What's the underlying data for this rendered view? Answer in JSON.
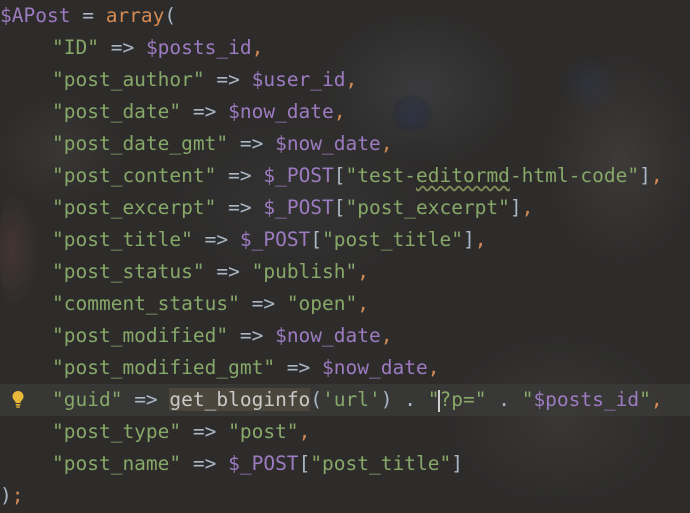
{
  "editor": {
    "lines": [
      {
        "tokens": [
          {
            "t": "$APost",
            "c": "var"
          },
          {
            "t": " = ",
            "c": "op"
          },
          {
            "t": "array",
            "c": "kw"
          },
          {
            "t": "(",
            "c": "op"
          }
        ]
      },
      {
        "indent": true,
        "tokens": [
          {
            "t": "\"ID\"",
            "c": "str"
          },
          {
            "t": " => ",
            "c": "op"
          },
          {
            "t": "$posts_id",
            "c": "var"
          },
          {
            "t": ",",
            "c": "kw"
          }
        ]
      },
      {
        "indent": true,
        "tokens": [
          {
            "t": "\"post_author\"",
            "c": "str"
          },
          {
            "t": " => ",
            "c": "op"
          },
          {
            "t": "$user_id",
            "c": "var"
          },
          {
            "t": ",",
            "c": "kw"
          }
        ]
      },
      {
        "indent": true,
        "tokens": [
          {
            "t": "\"post_date\"",
            "c": "str"
          },
          {
            "t": " => ",
            "c": "op"
          },
          {
            "t": "$now_date",
            "c": "var"
          },
          {
            "t": ",",
            "c": "kw"
          }
        ]
      },
      {
        "indent": true,
        "tokens": [
          {
            "t": "\"post_date_gmt\"",
            "c": "str"
          },
          {
            "t": " => ",
            "c": "op"
          },
          {
            "t": "$now_date",
            "c": "var"
          },
          {
            "t": ",",
            "c": "kw"
          }
        ]
      },
      {
        "indent": true,
        "tokens": [
          {
            "t": "\"post_content\"",
            "c": "str"
          },
          {
            "t": " => ",
            "c": "op"
          },
          {
            "t": "$_POST",
            "c": "var"
          },
          {
            "t": "[",
            "c": "op"
          },
          {
            "t": "\"test-",
            "c": "str"
          },
          {
            "t": "editormd",
            "c": "str squiggle"
          },
          {
            "t": "-html-code\"",
            "c": "str"
          },
          {
            "t": "]",
            "c": "op"
          },
          {
            "t": ",",
            "c": "kw"
          }
        ]
      },
      {
        "indent": true,
        "tokens": [
          {
            "t": "\"post_excerpt\"",
            "c": "str"
          },
          {
            "t": " => ",
            "c": "op"
          },
          {
            "t": "$_POST",
            "c": "var"
          },
          {
            "t": "[",
            "c": "op"
          },
          {
            "t": "\"post_excerpt\"",
            "c": "str"
          },
          {
            "t": "]",
            "c": "op"
          },
          {
            "t": ",",
            "c": "kw"
          }
        ]
      },
      {
        "indent": true,
        "tokens": [
          {
            "t": "\"post_title\"",
            "c": "str"
          },
          {
            "t": " => ",
            "c": "op"
          },
          {
            "t": "$_POST",
            "c": "var"
          },
          {
            "t": "[",
            "c": "op"
          },
          {
            "t": "\"post_title\"",
            "c": "str"
          },
          {
            "t": "]",
            "c": "op"
          },
          {
            "t": ",",
            "c": "kw"
          }
        ]
      },
      {
        "indent": true,
        "tokens": [
          {
            "t": "\"post_status\"",
            "c": "str"
          },
          {
            "t": " => ",
            "c": "op"
          },
          {
            "t": "\"publish\"",
            "c": "str"
          },
          {
            "t": ",",
            "c": "kw"
          }
        ]
      },
      {
        "indent": true,
        "tokens": [
          {
            "t": "\"comment_status\"",
            "c": "str"
          },
          {
            "t": " => ",
            "c": "op"
          },
          {
            "t": "\"open\"",
            "c": "str"
          },
          {
            "t": ",",
            "c": "kw"
          }
        ]
      },
      {
        "indent": true,
        "tokens": [
          {
            "t": "\"post_modified\"",
            "c": "str"
          },
          {
            "t": " => ",
            "c": "op"
          },
          {
            "t": "$now_date",
            "c": "var"
          },
          {
            "t": ",",
            "c": "kw"
          }
        ]
      },
      {
        "indent": true,
        "tokens": [
          {
            "t": "\"post_modified_gmt\"",
            "c": "str"
          },
          {
            "t": " => ",
            "c": "op"
          },
          {
            "t": "$now_date",
            "c": "var"
          },
          {
            "t": ",",
            "c": "kw"
          }
        ]
      },
      {
        "indent": true,
        "current": true,
        "tokens": [
          {
            "t": "\"guid\"",
            "c": "str"
          },
          {
            "t": " => ",
            "c": "op"
          },
          {
            "t": "get_bloginfo",
            "c": "fnhl"
          },
          {
            "t": "(",
            "c": "op"
          },
          {
            "t": "'url'",
            "c": "str"
          },
          {
            "t": ") . ",
            "c": "op"
          },
          {
            "t": "\"",
            "c": "str"
          },
          {
            "caret": true
          },
          {
            "t": "?p=\"",
            "c": "str"
          },
          {
            "t": " . ",
            "c": "op"
          },
          {
            "t": "\"",
            "c": "str"
          },
          {
            "t": "$posts_id",
            "c": "var"
          },
          {
            "t": "\"",
            "c": "str"
          },
          {
            "t": ",",
            "c": "kw"
          }
        ]
      },
      {
        "indent": true,
        "tokens": [
          {
            "t": "\"post_type\"",
            "c": "str"
          },
          {
            "t": " => ",
            "c": "op"
          },
          {
            "t": "\"post\"",
            "c": "str"
          },
          {
            "t": ",",
            "c": "kw"
          }
        ]
      },
      {
        "indent": true,
        "tokens": [
          {
            "t": "\"post_name\"",
            "c": "str"
          },
          {
            "t": " => ",
            "c": "op"
          },
          {
            "t": "$_POST",
            "c": "var"
          },
          {
            "t": "[",
            "c": "op"
          },
          {
            "t": "\"post_title\"",
            "c": "str"
          },
          {
            "t": "]",
            "c": "op"
          }
        ]
      },
      {
        "tokens": [
          {
            "t": ")",
            "c": "op"
          },
          {
            "t": ";",
            "c": "kw"
          }
        ]
      }
    ],
    "gutter": {
      "intention_icon": "lightbulb-icon",
      "intention_icon_color": "#e8b83a"
    },
    "colors": {
      "string": "#87a868",
      "variable": "#9d7bc0",
      "keyword": "#d48a52",
      "plain": "#a9b7c6",
      "current_line": "#3a3a38",
      "identifier_highlight": "#4a463b"
    }
  }
}
